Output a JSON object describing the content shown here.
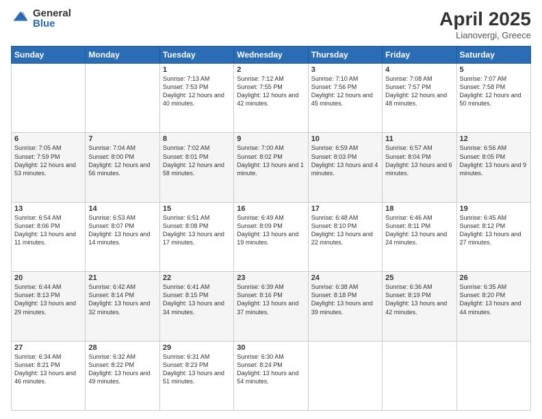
{
  "logo": {
    "general": "General",
    "blue": "Blue"
  },
  "title": {
    "month_year": "April 2025",
    "location": "Lianovergi, Greece"
  },
  "headers": [
    "Sunday",
    "Monday",
    "Tuesday",
    "Wednesday",
    "Thursday",
    "Friday",
    "Saturday"
  ],
  "weeks": [
    [
      {
        "day": "",
        "sunrise": "",
        "sunset": "",
        "daylight": ""
      },
      {
        "day": "",
        "sunrise": "",
        "sunset": "",
        "daylight": ""
      },
      {
        "day": "1",
        "sunrise": "Sunrise: 7:13 AM",
        "sunset": "Sunset: 7:53 PM",
        "daylight": "Daylight: 12 hours and 40 minutes."
      },
      {
        "day": "2",
        "sunrise": "Sunrise: 7:12 AM",
        "sunset": "Sunset: 7:55 PM",
        "daylight": "Daylight: 12 hours and 42 minutes."
      },
      {
        "day": "3",
        "sunrise": "Sunrise: 7:10 AM",
        "sunset": "Sunset: 7:56 PM",
        "daylight": "Daylight: 12 hours and 45 minutes."
      },
      {
        "day": "4",
        "sunrise": "Sunrise: 7:08 AM",
        "sunset": "Sunset: 7:57 PM",
        "daylight": "Daylight: 12 hours and 48 minutes."
      },
      {
        "day": "5",
        "sunrise": "Sunrise: 7:07 AM",
        "sunset": "Sunset: 7:58 PM",
        "daylight": "Daylight: 12 hours and 50 minutes."
      }
    ],
    [
      {
        "day": "6",
        "sunrise": "Sunrise: 7:05 AM",
        "sunset": "Sunset: 7:59 PM",
        "daylight": "Daylight: 12 hours and 53 minutes."
      },
      {
        "day": "7",
        "sunrise": "Sunrise: 7:04 AM",
        "sunset": "Sunset: 8:00 PM",
        "daylight": "Daylight: 12 hours and 56 minutes."
      },
      {
        "day": "8",
        "sunrise": "Sunrise: 7:02 AM",
        "sunset": "Sunset: 8:01 PM",
        "daylight": "Daylight: 12 hours and 58 minutes."
      },
      {
        "day": "9",
        "sunrise": "Sunrise: 7:00 AM",
        "sunset": "Sunset: 8:02 PM",
        "daylight": "Daylight: 13 hours and 1 minute."
      },
      {
        "day": "10",
        "sunrise": "Sunrise: 6:59 AM",
        "sunset": "Sunset: 8:03 PM",
        "daylight": "Daylight: 13 hours and 4 minutes."
      },
      {
        "day": "11",
        "sunrise": "Sunrise: 6:57 AM",
        "sunset": "Sunset: 8:04 PM",
        "daylight": "Daylight: 13 hours and 6 minutes."
      },
      {
        "day": "12",
        "sunrise": "Sunrise: 6:56 AM",
        "sunset": "Sunset: 8:05 PM",
        "daylight": "Daylight: 13 hours and 9 minutes."
      }
    ],
    [
      {
        "day": "13",
        "sunrise": "Sunrise: 6:54 AM",
        "sunset": "Sunset: 8:06 PM",
        "daylight": "Daylight: 13 hours and 11 minutes."
      },
      {
        "day": "14",
        "sunrise": "Sunrise: 6:53 AM",
        "sunset": "Sunset: 8:07 PM",
        "daylight": "Daylight: 13 hours and 14 minutes."
      },
      {
        "day": "15",
        "sunrise": "Sunrise: 6:51 AM",
        "sunset": "Sunset: 8:08 PM",
        "daylight": "Daylight: 13 hours and 17 minutes."
      },
      {
        "day": "16",
        "sunrise": "Sunrise: 6:49 AM",
        "sunset": "Sunset: 8:09 PM",
        "daylight": "Daylight: 13 hours and 19 minutes."
      },
      {
        "day": "17",
        "sunrise": "Sunrise: 6:48 AM",
        "sunset": "Sunset: 8:10 PM",
        "daylight": "Daylight: 13 hours and 22 minutes."
      },
      {
        "day": "18",
        "sunrise": "Sunrise: 6:46 AM",
        "sunset": "Sunset: 8:11 PM",
        "daylight": "Daylight: 13 hours and 24 minutes."
      },
      {
        "day": "19",
        "sunrise": "Sunrise: 6:45 AM",
        "sunset": "Sunset: 8:12 PM",
        "daylight": "Daylight: 13 hours and 27 minutes."
      }
    ],
    [
      {
        "day": "20",
        "sunrise": "Sunrise: 6:44 AM",
        "sunset": "Sunset: 8:13 PM",
        "daylight": "Daylight: 13 hours and 29 minutes."
      },
      {
        "day": "21",
        "sunrise": "Sunrise: 6:42 AM",
        "sunset": "Sunset: 8:14 PM",
        "daylight": "Daylight: 13 hours and 32 minutes."
      },
      {
        "day": "22",
        "sunrise": "Sunrise: 6:41 AM",
        "sunset": "Sunset: 8:15 PM",
        "daylight": "Daylight: 13 hours and 34 minutes."
      },
      {
        "day": "23",
        "sunrise": "Sunrise: 6:39 AM",
        "sunset": "Sunset: 8:16 PM",
        "daylight": "Daylight: 13 hours and 37 minutes."
      },
      {
        "day": "24",
        "sunrise": "Sunrise: 6:38 AM",
        "sunset": "Sunset: 8:18 PM",
        "daylight": "Daylight: 13 hours and 39 minutes."
      },
      {
        "day": "25",
        "sunrise": "Sunrise: 6:36 AM",
        "sunset": "Sunset: 8:19 PM",
        "daylight": "Daylight: 13 hours and 42 minutes."
      },
      {
        "day": "26",
        "sunrise": "Sunrise: 6:35 AM",
        "sunset": "Sunset: 8:20 PM",
        "daylight": "Daylight: 13 hours and 44 minutes."
      }
    ],
    [
      {
        "day": "27",
        "sunrise": "Sunrise: 6:34 AM",
        "sunset": "Sunset: 8:21 PM",
        "daylight": "Daylight: 13 hours and 46 minutes."
      },
      {
        "day": "28",
        "sunrise": "Sunrise: 6:32 AM",
        "sunset": "Sunset: 8:22 PM",
        "daylight": "Daylight: 13 hours and 49 minutes."
      },
      {
        "day": "29",
        "sunrise": "Sunrise: 6:31 AM",
        "sunset": "Sunset: 8:23 PM",
        "daylight": "Daylight: 13 hours and 51 minutes."
      },
      {
        "day": "30",
        "sunrise": "Sunrise: 6:30 AM",
        "sunset": "Sunset: 8:24 PM",
        "daylight": "Daylight: 13 hours and 54 minutes."
      },
      {
        "day": "",
        "sunrise": "",
        "sunset": "",
        "daylight": ""
      },
      {
        "day": "",
        "sunrise": "",
        "sunset": "",
        "daylight": ""
      },
      {
        "day": "",
        "sunrise": "",
        "sunset": "",
        "daylight": ""
      }
    ]
  ]
}
